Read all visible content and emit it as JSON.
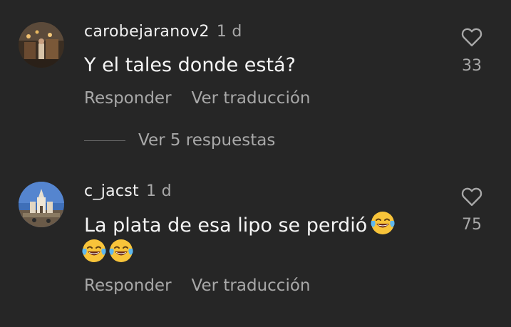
{
  "comments": [
    {
      "username": "carobejaranov2",
      "time": "1 d",
      "text": "Y el tales donde está?",
      "likes": "33",
      "reply_label": "Responder",
      "translate_label": "Ver traducción"
    },
    {
      "username": "c_jacst",
      "time": "1 d",
      "text": "La plata de esa lipo se perdió",
      "emoji_name": "face-with-tears-of-joy",
      "likes": "75",
      "reply_label": "Responder",
      "translate_label": "Ver traducción"
    }
  ],
  "view_replies_label": "Ver 5 respuestas",
  "colors": {
    "background": "#262626",
    "primary_text": "#f5f5f5",
    "secondary_text": "#a8a8a8"
  }
}
